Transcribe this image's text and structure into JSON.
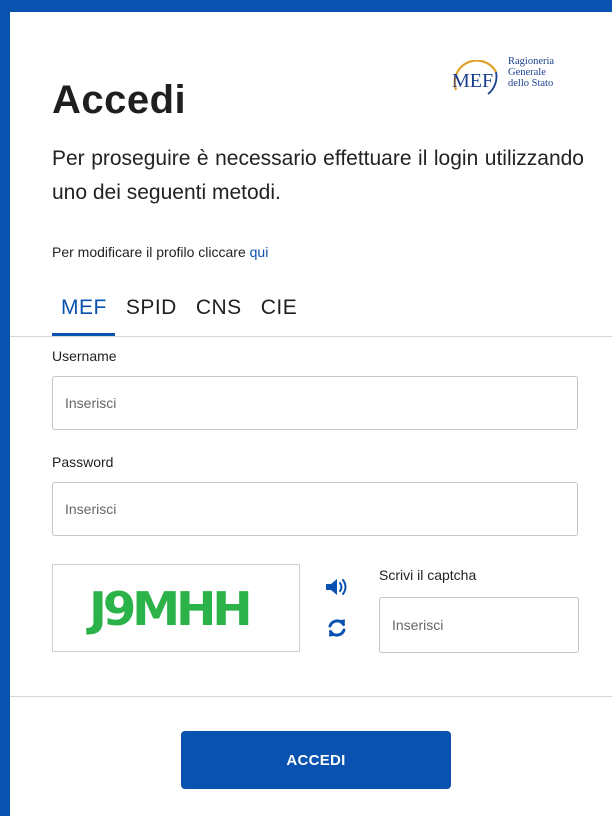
{
  "page": {
    "title": "Accedi",
    "intro": "Per proseguire è necessario effettuare il login utilizzando uno dei seguenti metodi.",
    "profile_text": "Per modificare il profilo cliccare ",
    "profile_link": "qui"
  },
  "logo": {
    "mark": "MEF",
    "org_line1": "Ragioneria",
    "org_line2": "Generale",
    "org_line3": "dello Stato"
  },
  "tabs": [
    {
      "label": "MEF",
      "active": true
    },
    {
      "label": "SPID",
      "active": false
    },
    {
      "label": "CNS",
      "active": false
    },
    {
      "label": "CIE",
      "active": false
    }
  ],
  "form": {
    "username_label": "Username",
    "username_placeholder": "Inserisci",
    "password_label": "Password",
    "password_placeholder": "Inserisci",
    "captcha_image_text": "J9MHH",
    "captcha_label": "Scrivi il captcha",
    "captcha_placeholder": "Inserisci",
    "audio_icon": "volume-icon",
    "refresh_icon": "refresh-icon",
    "submit_label": "ACCEDI"
  },
  "colors": {
    "brand_blue": "#0a52b0",
    "captcha_green": "#2bb34a",
    "logo_gold": "#e0a02a",
    "logo_navy": "#1b3f8f"
  }
}
